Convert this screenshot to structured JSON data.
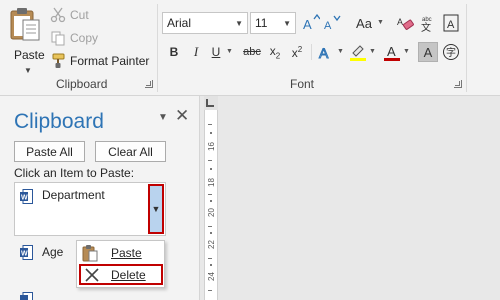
{
  "ribbon": {
    "clipboard_group": {
      "paste_label": "Paste",
      "cut_label": "Cut",
      "copy_label": "Copy",
      "format_painter_label": "Format Painter",
      "group_label": "Clipboard"
    },
    "font_group": {
      "font_name": "Arial",
      "font_size": "11",
      "bold": "B",
      "italic": "I",
      "underline": "U",
      "strikethrough": "abc",
      "subscript_base": "x",
      "subscript_sub": "2",
      "superscript_base": "x",
      "superscript_sup": "2",
      "change_case": "Aa",
      "font_color_letter": "A",
      "group_label": "Font"
    }
  },
  "pane": {
    "title": "Clipboard",
    "paste_all_label": "Paste All",
    "clear_all_label": "Clear All",
    "instruction": "Click an Item to Paste:",
    "items": [
      {
        "text": "Department"
      },
      {
        "text": "Age"
      }
    ]
  },
  "context_menu": {
    "items": [
      {
        "label": "Paste"
      },
      {
        "label": "Delete"
      }
    ]
  },
  "ruler": {
    "labels": [
      "16",
      "18",
      "20",
      "22",
      "24"
    ]
  },
  "colors": {
    "accent_blue": "#2e74b5",
    "highlight_red": "#c00000",
    "highlight_yellow": "#ffff00",
    "font_color_red": "#c00000",
    "dropdown_blue": "#b9d3ee"
  },
  "icons": {
    "paste": "clipboard-paste-icon",
    "cut": "scissors-icon",
    "copy": "copy-icon",
    "format_painter": "paintbrush-icon",
    "grow_font": "grow-font-icon",
    "shrink_font": "shrink-font-icon",
    "clear_formatting": "eraser-icon",
    "text_effects": "text-effects-icon",
    "highlight": "highlighter-icon",
    "font_color": "font-color-icon",
    "phonetic": "phonetic-guide-icon",
    "enclose": "enclose-characters-icon",
    "word_doc": "word-document-icon",
    "delete": "delete-x-icon"
  }
}
